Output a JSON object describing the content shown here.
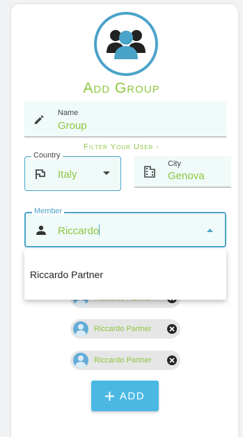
{
  "title": "Add Group",
  "name_field": {
    "label": "Name",
    "value": "Group",
    "icon": "pencil-icon"
  },
  "filter_title": "Filter Your User -",
  "country_field": {
    "label": "Country",
    "value": "Italy",
    "icon": "flag-icon"
  },
  "city_field": {
    "label": "City",
    "value": "Genova",
    "icon": "building-icon"
  },
  "member_field": {
    "label": "Member",
    "value": "Riccardo",
    "icon": "person-icon"
  },
  "dropdown": {
    "options": [
      "Riccardo Partner"
    ]
  },
  "chips": [
    {
      "label": "Riccardo Partner"
    },
    {
      "label": "Riccardo Partner"
    },
    {
      "label": "Riccardo Partner"
    }
  ],
  "add_button": {
    "label": "ADD",
    "icon": "plus-icon"
  },
  "colors": {
    "accent_green": "#8dc63f",
    "accent_blue": "#4aa3c9",
    "button_blue": "#4bb8e4"
  }
}
